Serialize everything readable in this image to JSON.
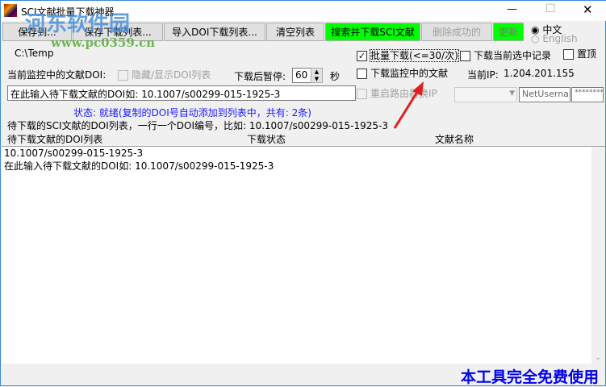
{
  "window": {
    "title": "SCI文献批量下载神器",
    "minimize": "—",
    "maximize": "☐",
    "close": "✕"
  },
  "watermark": {
    "name": "河东软件园",
    "url": "www.pc0359.cn"
  },
  "toolbar": {
    "save_to": "保存到...",
    "save_list": "保存下载列表...",
    "import_list": "导入DOI下载列表...",
    "clear_list": "清空列表",
    "search_download": "搜索并下载SCI文献",
    "delete_success": "删除成功的",
    "update": "更新"
  },
  "language": {
    "zh": "中文",
    "en": "English"
  },
  "path": "C:\\Temp",
  "monitor": {
    "label": "当前监控中的文献DOI:",
    "toggle_list": "隐藏/显示DOI列表",
    "pause_label": "下载后暂停:",
    "pause_value": "60",
    "pause_unit": "秒"
  },
  "options": {
    "batch": "批量下载(<=30/次)",
    "download_selected": "下载当前选中记录",
    "pin": "置顶",
    "download_monitor": "下载监控中的文献",
    "restart_router": "重启路由器换IP",
    "ip_label": "当前IP:",
    "ip_value": "1.204.201.155"
  },
  "inputs": {
    "doi_input": "在此输入待下载文献的DOI如: 10.1007/s00299-015-1925-3",
    "username": "NetUsernam",
    "password": "*********"
  },
  "status": "状态: 就绪(复制的DOI号自动添加到列表中，共有: 2条)",
  "hint": "待下载的SCI文献的DOI列表，一行一个DOI编号，比如: 10.1007/s00299-015-1925-3",
  "columns": [
    "待下载文献的DOI列表",
    "下载状态",
    "文献名称"
  ],
  "rows": [
    "10.1007/s00299-015-1925-3",
    "在此输入待下载文献的DOI如: 10.1007/s00299-015-1925-3"
  ],
  "footer": "本工具完全免费使用"
}
